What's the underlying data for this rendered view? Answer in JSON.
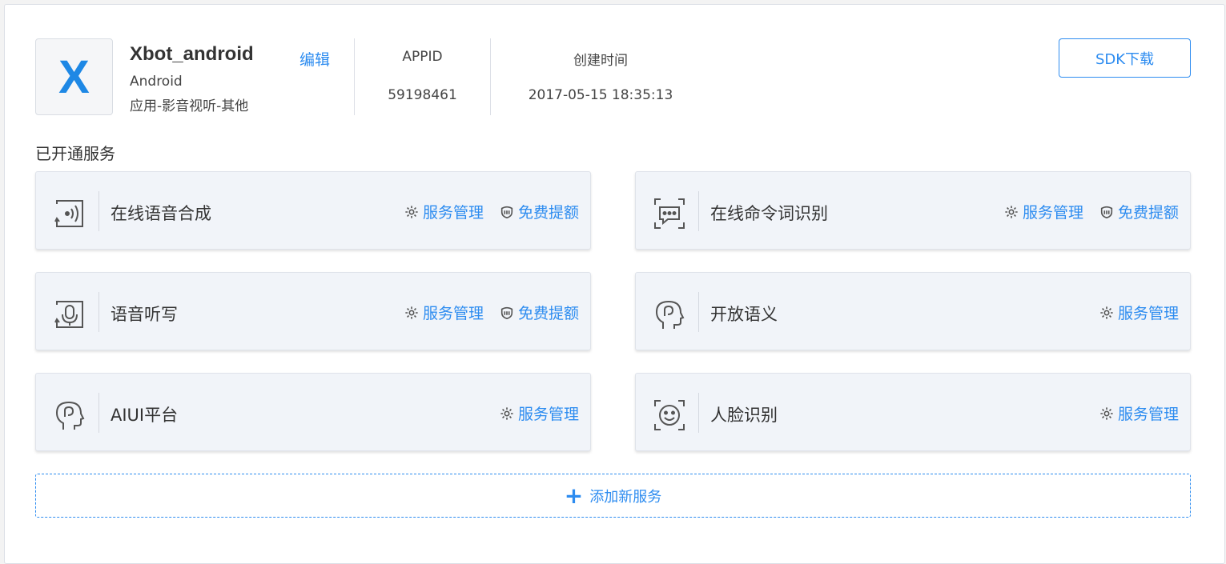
{
  "app": {
    "logo_letter": "X",
    "name": "Xbot_android",
    "platform": "Android",
    "category": "应用-影音视听-其他",
    "edit_label": "编辑",
    "appid_label": "APPID",
    "appid_value": "59198461",
    "created_label": "创建时间",
    "created_value": "2017-05-15 18:35:13",
    "sdk_button": "SDK下载"
  },
  "services_title": "已开通服务",
  "services": [
    {
      "name": "在线语音合成",
      "icon": "speaker-wave-icon",
      "manage": "服务管理",
      "quota": "免费提额"
    },
    {
      "name": "在线命令词识别",
      "icon": "chat-bubble-scan-icon",
      "manage": "服务管理",
      "quota": "免费提额"
    },
    {
      "name": "语音听写",
      "icon": "microphone-icon",
      "manage": "服务管理",
      "quota": "免费提额"
    },
    {
      "name": "开放语义",
      "icon": "head-icon",
      "manage": "服务管理"
    },
    {
      "name": "AIUI平台",
      "icon": "head-icon",
      "manage": "服务管理"
    },
    {
      "name": "人脸识别",
      "icon": "face-scan-icon",
      "manage": "服务管理"
    }
  ],
  "add_service_label": "添加新服务",
  "colors": {
    "accent": "#2d8cf0",
    "card_bg": "#f1f4f9"
  }
}
